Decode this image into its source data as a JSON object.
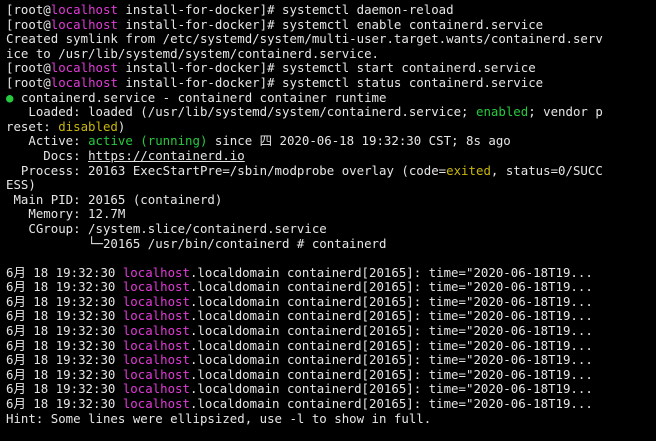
{
  "terminal": {
    "colors": {
      "background": "#000000",
      "text": "#e6e6e6",
      "host": "#e23ad8",
      "green": "#27c93f",
      "yellow": "#c9b70a"
    },
    "prompt": {
      "open": "[root@",
      "host": "localhost",
      "dir": " install-for-docker]# "
    },
    "lines": [
      {
        "cmd": "systemctl daemon-reload"
      },
      {
        "cmd": "systemctl enable containerd.service"
      },
      {
        "text": "Created symlink from /etc/systemd/system/multi-user.target.wants/containerd.serv"
      },
      {
        "text": "ice to /usr/lib/systemd/system/containerd.service."
      },
      {
        "cmd": "systemctl start containerd.service"
      },
      {
        "cmd": "systemctl status containerd.service"
      },
      {
        "dot": "●",
        "text": " containerd.service - containerd container runtime"
      },
      {
        "loaded_label": "   Loaded: ",
        "loaded_pre": "loaded (/usr/lib/systemd/system/containerd.service; ",
        "enabled": "enabled",
        "loaded_post": "; vendor p"
      },
      {
        "preset_pre": "reset: ",
        "preset_val": "disabled",
        "preset_post": ")"
      },
      {
        "active_label": "   Active: ",
        "active_val": "active (running)",
        "active_post": " since 四 2020-06-18 19:32:30 CST; 8s ago"
      },
      {
        "docs_label": "     Docs: ",
        "docs_link": "https://containerd.io"
      },
      {
        "process_pre": "  Process: 20163 ExecStartPre=/sbin/modprobe overlay (code=",
        "process_code": "exited",
        "process_post": ", status=0/SUCC"
      },
      {
        "text": "ESS)"
      },
      {
        "text": " Main PID: 20165 (containerd)"
      },
      {
        "text": "   Memory: 12.7M"
      },
      {
        "text": "   CGroup: /system.slice/containerd.service"
      },
      {
        "text": "           └─20165 /usr/bin/containerd # containerd"
      },
      {
        "text": ""
      },
      {
        "log_time": "6月 18 19:32:30 ",
        "log_host": "localhost",
        "log_rest": ".localdomain containerd[20165]: time=\"2020-06-18T19..."
      },
      {
        "log_time": "6月 18 19:32:30 ",
        "log_host": "localhost",
        "log_rest": ".localdomain containerd[20165]: time=\"2020-06-18T19..."
      },
      {
        "log_time": "6月 18 19:32:30 ",
        "log_host": "localhost",
        "log_rest": ".localdomain containerd[20165]: time=\"2020-06-18T19..."
      },
      {
        "log_time": "6月 18 19:32:30 ",
        "log_host": "localhost",
        "log_rest": ".localdomain containerd[20165]: time=\"2020-06-18T19..."
      },
      {
        "log_time": "6月 18 19:32:30 ",
        "log_host": "localhost",
        "log_rest": ".localdomain containerd[20165]: time=\"2020-06-18T19..."
      },
      {
        "log_time": "6月 18 19:32:30 ",
        "log_host": "localhost",
        "log_rest": ".localdomain containerd[20165]: time=\"2020-06-18T19..."
      },
      {
        "log_time": "6月 18 19:32:30 ",
        "log_host": "localhost",
        "log_rest": ".localdomain containerd[20165]: time=\"2020-06-18T19..."
      },
      {
        "log_time": "6月 18 19:32:30 ",
        "log_host": "localhost",
        "log_rest": ".localdomain containerd[20165]: time=\"2020-06-18T19..."
      },
      {
        "log_time": "6月 18 19:32:30 ",
        "log_host": "localhost",
        "log_rest": ".localdomain containerd[20165]: time=\"2020-06-18T19..."
      },
      {
        "log_time": "6月 18 19:32:30 ",
        "log_host": "localhost",
        "log_rest": ".localdomain containerd[20165]: time=\"2020-06-18T19..."
      },
      {
        "text": "Hint: Some lines were ellipsized, use -l to show in full."
      }
    ]
  }
}
